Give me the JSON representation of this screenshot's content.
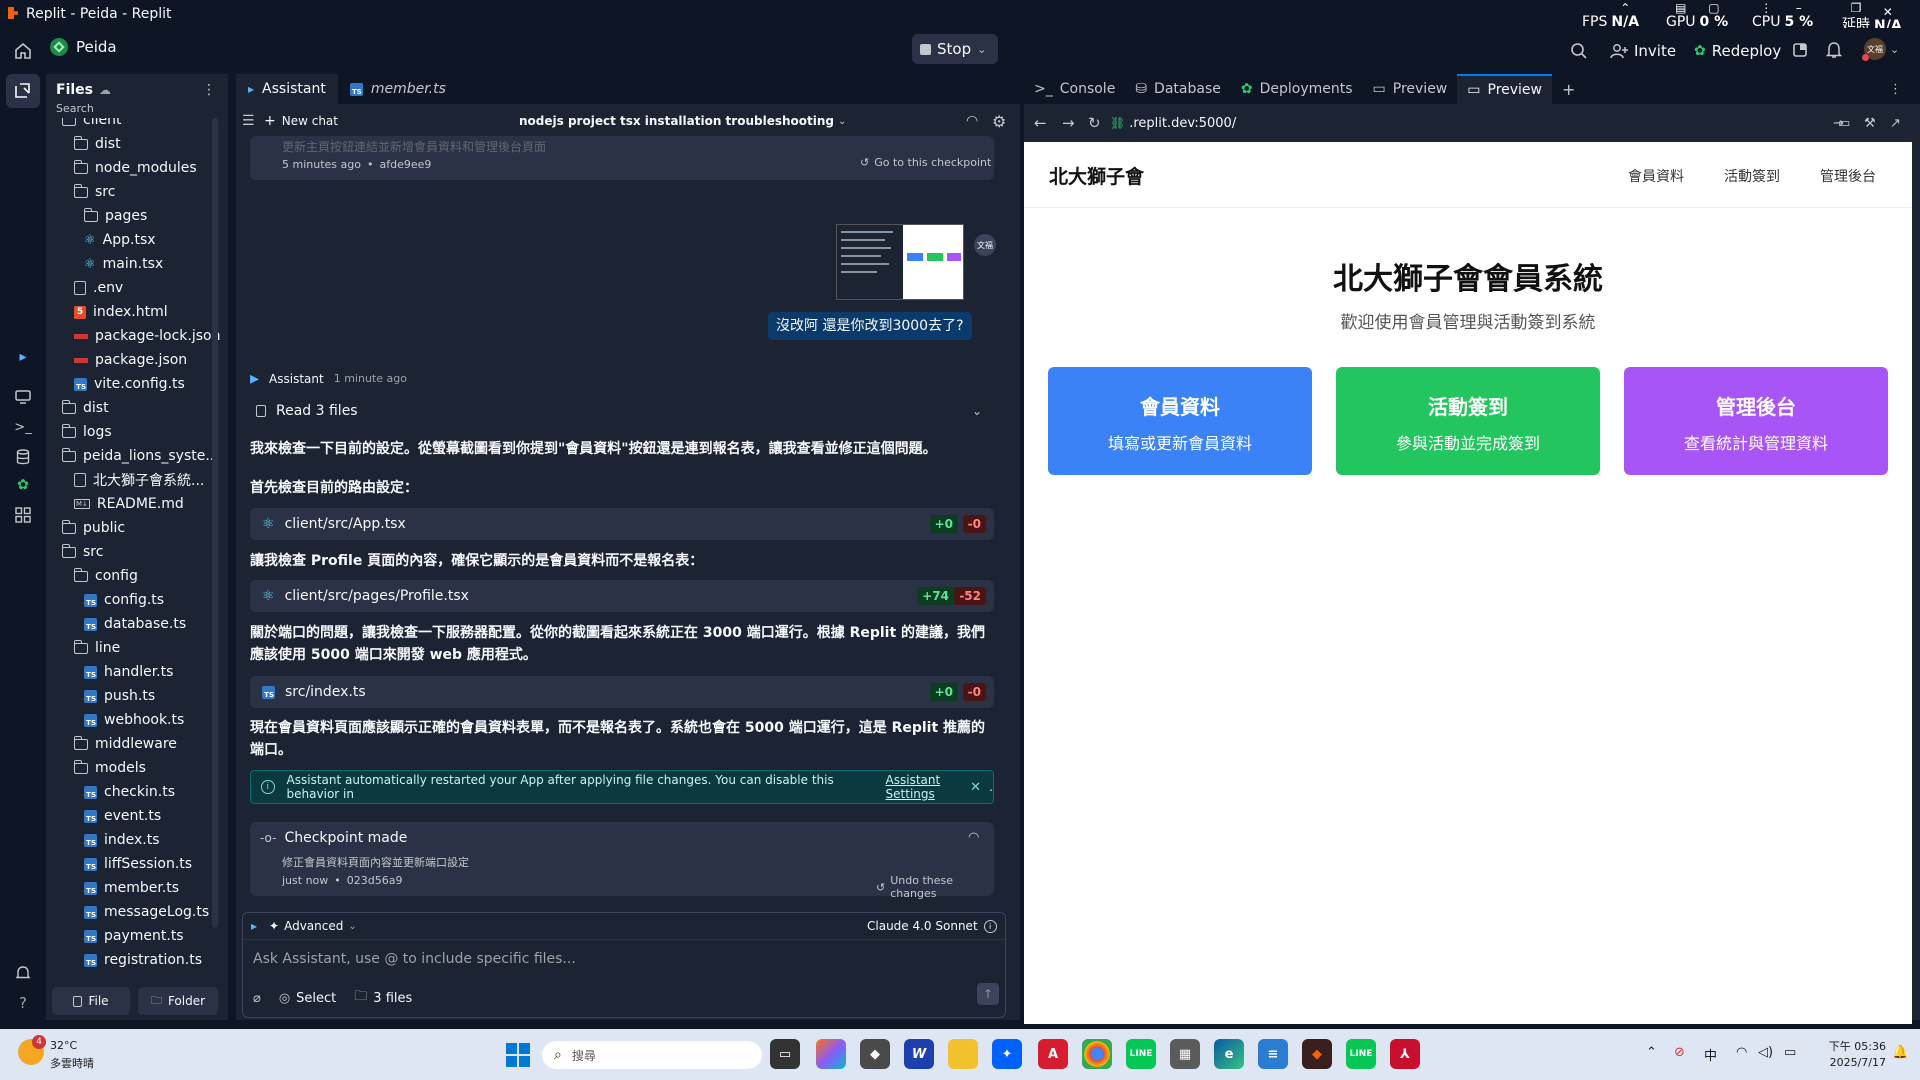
{
  "window": {
    "title": "Replit - Peida - Replit"
  },
  "perf": {
    "fps_label": "FPS",
    "fps_value": "N/A",
    "gpu_label": "GPU",
    "gpu_value": "0 %",
    "cpu_label": "CPU",
    "cpu_value": "5 %",
    "lat_label": "延時",
    "lat_value": "N/A"
  },
  "header": {
    "project": "Peida",
    "stop": "Stop",
    "invite": "Invite",
    "redeploy": "Redeploy",
    "avatar_text": "文福"
  },
  "files": {
    "title": "Files",
    "search_placeholder": "Search",
    "items": [
      {
        "name": "client",
        "kind": "folder",
        "indent": 0
      },
      {
        "name": "dist",
        "kind": "folder",
        "indent": 1
      },
      {
        "name": "node_modules",
        "kind": "folder",
        "indent": 1
      },
      {
        "name": "src",
        "kind": "folder",
        "indent": 1
      },
      {
        "name": "pages",
        "kind": "folder",
        "indent": 2
      },
      {
        "name": "App.tsx",
        "kind": "react",
        "indent": 2
      },
      {
        "name": "main.tsx",
        "kind": "react",
        "indent": 2
      },
      {
        "name": ".env",
        "kind": "file",
        "indent": 1
      },
      {
        "name": "index.html",
        "kind": "html",
        "indent": 1
      },
      {
        "name": "package-lock.json",
        "kind": "npm",
        "indent": 1
      },
      {
        "name": "package.json",
        "kind": "npm",
        "indent": 1
      },
      {
        "name": "vite.config.ts",
        "kind": "ts",
        "indent": 1
      },
      {
        "name": "dist",
        "kind": "folder",
        "indent": 0
      },
      {
        "name": "logs",
        "kind": "folder",
        "indent": 0
      },
      {
        "name": "peida_lions_syste...",
        "kind": "folder",
        "indent": 0
      },
      {
        "name": "北大獅子會系統...",
        "kind": "file",
        "indent": 1
      },
      {
        "name": "README.md",
        "kind": "md",
        "indent": 1
      },
      {
        "name": "public",
        "kind": "folder",
        "indent": 0
      },
      {
        "name": "src",
        "kind": "folder",
        "indent": 0
      },
      {
        "name": "config",
        "kind": "folder",
        "indent": 1
      },
      {
        "name": "config.ts",
        "kind": "ts",
        "indent": 2
      },
      {
        "name": "database.ts",
        "kind": "ts",
        "indent": 2
      },
      {
        "name": "line",
        "kind": "folder",
        "indent": 1
      },
      {
        "name": "handler.ts",
        "kind": "ts",
        "indent": 2
      },
      {
        "name": "push.ts",
        "kind": "ts",
        "indent": 2
      },
      {
        "name": "webhook.ts",
        "kind": "ts",
        "indent": 2
      },
      {
        "name": "middleware",
        "kind": "folder",
        "indent": 1
      },
      {
        "name": "models",
        "kind": "folder",
        "indent": 1
      },
      {
        "name": "checkin.ts",
        "kind": "ts",
        "indent": 2
      },
      {
        "name": "event.ts",
        "kind": "ts",
        "indent": 2
      },
      {
        "name": "index.ts",
        "kind": "ts",
        "indent": 2
      },
      {
        "name": "liffSession.ts",
        "kind": "ts",
        "indent": 2
      },
      {
        "name": "member.ts",
        "kind": "ts",
        "indent": 2
      },
      {
        "name": "messageLog.ts",
        "kind": "ts",
        "indent": 2
      },
      {
        "name": "payment.ts",
        "kind": "ts",
        "indent": 2
      },
      {
        "name": "registration.ts",
        "kind": "ts",
        "indent": 2
      }
    ],
    "new_file": "File",
    "new_folder": "Folder"
  },
  "chat": {
    "tabs": [
      "Assistant",
      "member.ts"
    ],
    "new_chat": "New chat",
    "chat_title": "nodejs project tsx installation troubleshooting",
    "prev_checkpoint_msg": "更新主頁按鈕連結並新增會員資料和管理後台頁面",
    "prev_time": "5 minutes ago",
    "prev_hash": "afde9ee9",
    "go_checkpoint": "Go to this checkpoint",
    "user_avatar": "文福",
    "user_msg": "沒改阿 還是你改到3000去了?",
    "assistant_name": "Assistant",
    "assistant_time": "1 minute ago",
    "read_files": "Read 3 files",
    "p1": "我來檢查一下目前的設定。從螢幕截圖看到你提到\"會員資料\"按鈕還是連到報名表，讓我查看並修正這個問題。",
    "p2": "首先檢查目前的路由設定：",
    "file1": {
      "path": "client/src/App.tsx",
      "add": "+0",
      "del": "-0"
    },
    "p3": "讓我檢查 Profile 頁面的內容，確保它顯示的是會員資料而不是報名表：",
    "file2": {
      "path": "client/src/pages/Profile.tsx",
      "add": "+74",
      "del": "-52"
    },
    "p4": "關於端口的問題，讓我檢查一下服務器配置。從你的截圖看起來系統正在 3000 端口運行。根據 Replit 的建議，我們應該使用 5000 端口來開發 web 應用程式。",
    "file3": {
      "path": "src/index.ts",
      "add": "+0",
      "del": "-0"
    },
    "p5": "現在會員資料頁面應該顯示正確的會員資料表單，而不是報名表了。系統也會在 5000 端口運行，這是 Replit 推薦的端口。",
    "notice": "Assistant automatically restarted your App after applying file changes. You can disable this behavior in",
    "notice_link": "Assistant Settings",
    "checkpoint_title": "Checkpoint made",
    "checkpoint_msg": "修正會員資料頁面內容並更新端口設定",
    "checkpoint_time": "just now",
    "checkpoint_hash": "023d56a9",
    "undo": "Undo these changes",
    "advanced": "Advanced",
    "model": "Claude 4.0 Sonnet",
    "input_placeholder": "Ask Assistant, use @ to include specific files...",
    "select": "Select",
    "files_count": "3 files"
  },
  "right": {
    "tabs": [
      "Console",
      "Database",
      "Deployments",
      "Preview",
      "Preview"
    ],
    "url": ".replit.dev:5000/"
  },
  "preview": {
    "brand": "北大獅子會",
    "nav": [
      "會員資料",
      "活動簽到",
      "管理後台"
    ],
    "title": "北大獅子會會員系統",
    "subtitle": "歡迎使用會員管理與活動簽到系統",
    "cards": [
      {
        "title": "會員資料",
        "desc": "填寫或更新會員資料",
        "color": "#3b82f6"
      },
      {
        "title": "活動簽到",
        "desc": "參與活動並完成簽到",
        "color": "#22c55e"
      },
      {
        "title": "管理後台",
        "desc": "查看統計與管理資料",
        "color": "#a855f7"
      }
    ]
  },
  "taskbar": {
    "weather_temp": "32°C",
    "weather_desc": "多雲時晴",
    "weather_badge": "4",
    "search_placeholder": "搜尋",
    "ime": "中",
    "time": "下午 05:36",
    "date": "2025/7/17"
  },
  "colors": {
    "accent": "#0079f2",
    "bg": "#0e1525",
    "panel": "#1c2333",
    "card": "#2b3245"
  }
}
